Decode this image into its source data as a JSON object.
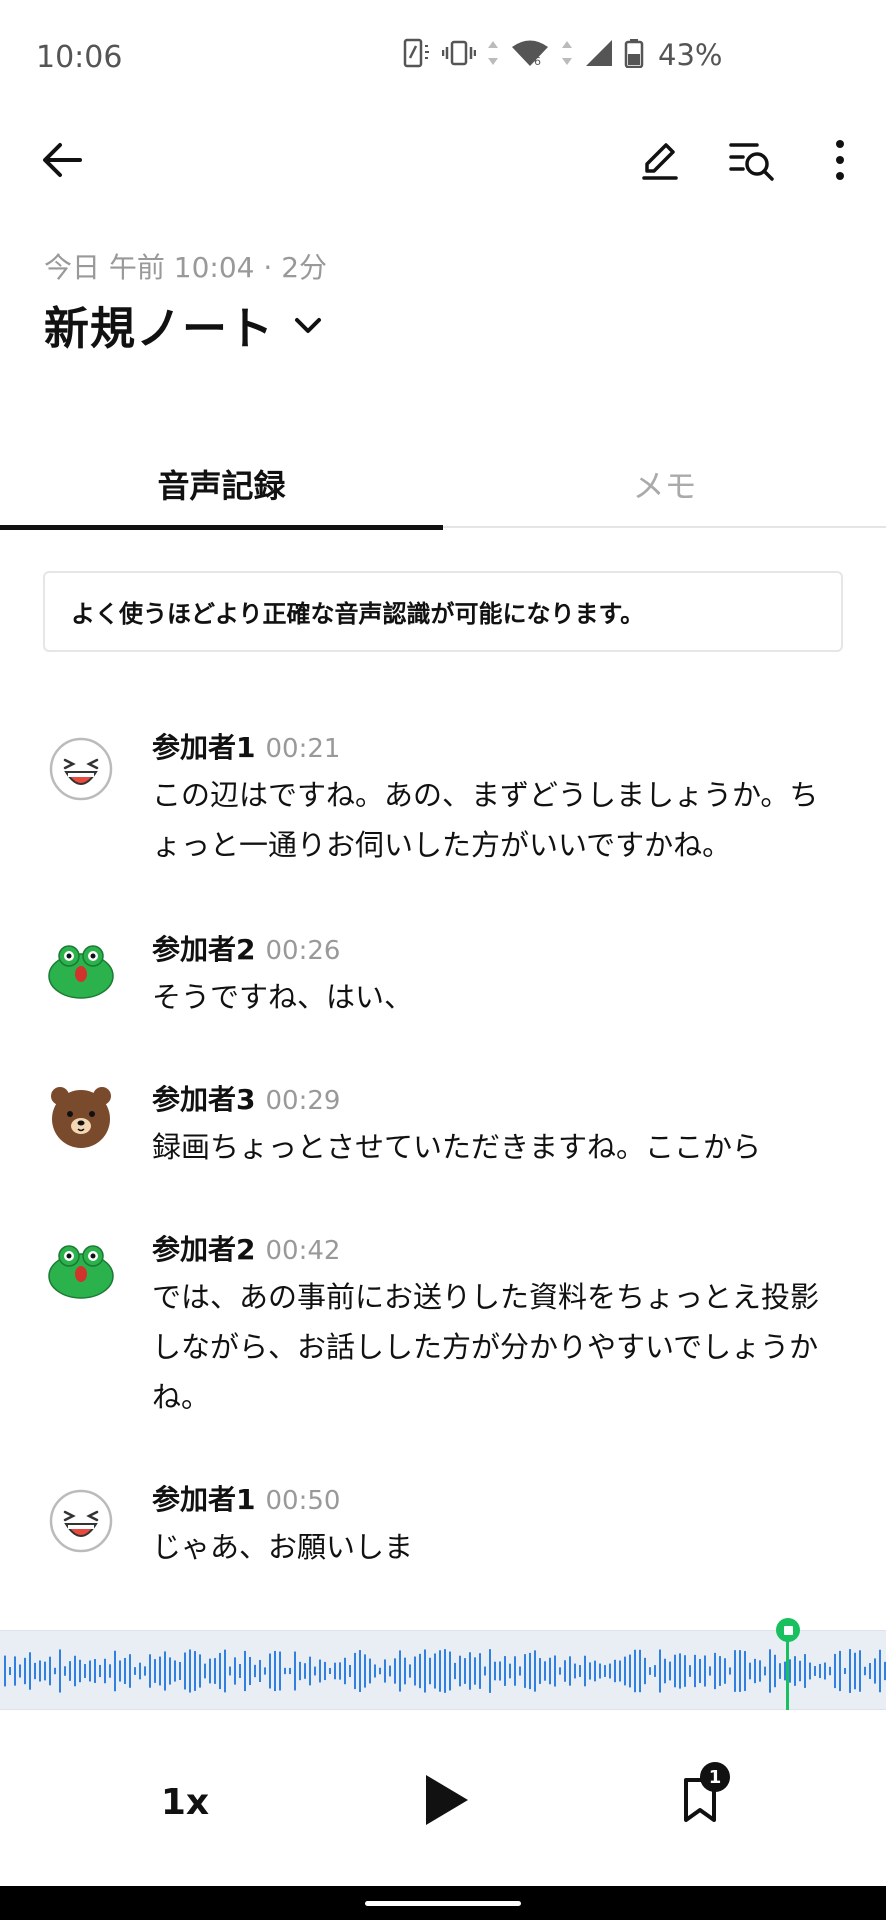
{
  "status_bar": {
    "time": "10:06",
    "battery": "43%"
  },
  "header": {
    "meta": "今日 午前 10:04 · 2分",
    "title": "新規ノート"
  },
  "tabs": [
    {
      "label": "音声記録",
      "active": true
    },
    {
      "label": "メモ",
      "active": false
    }
  ],
  "notice": "よく使うほどより正確な音声認識が可能になります。",
  "transcript": [
    {
      "speaker": "参加者1",
      "time": "00:21",
      "avatar": "laughing-face",
      "text": "この辺はですね。あの、まずどうしましょうか。ちょっと一通りお伺いした方がいいですかね。"
    },
    {
      "speaker": "参加者2",
      "time": "00:26",
      "avatar": "frog",
      "text": "そうですね、はい、"
    },
    {
      "speaker": "参加者3",
      "time": "00:29",
      "avatar": "bear",
      "text": "録画ちょっとさせていただきますね。ここから"
    },
    {
      "speaker": "参加者2",
      "time": "00:42",
      "avatar": "frog",
      "text": "では、あの事前にお送りした資料をちょっとえ投影しながら、お話しした方が分かりやすいでしょうかね。"
    },
    {
      "speaker": "参加者1",
      "time": "00:50",
      "avatar": "laughing-face",
      "text": "じゃあ、お願いしま"
    }
  ],
  "player": {
    "speed": "1x",
    "bookmark_count": "1",
    "accent_color": "#19c05f",
    "wave_color": "#2f80e0"
  }
}
